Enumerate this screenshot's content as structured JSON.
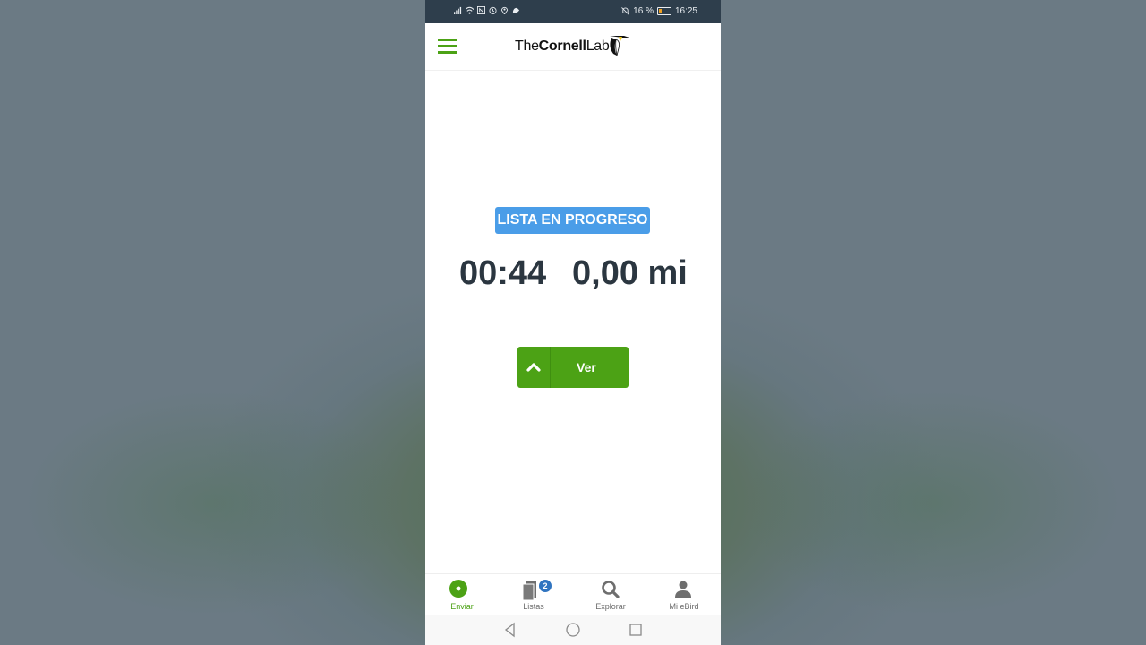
{
  "status_bar": {
    "battery_percent": "16 %",
    "time": "16:25",
    "icons": [
      "signal-icon",
      "wifi-icon",
      "nfc-icon",
      "alarm-icon",
      "location-icon",
      "app-notification-icon",
      "mute-icon",
      "battery-icon"
    ]
  },
  "header": {
    "logo_prefix": "The",
    "logo_bold": "Cornell",
    "logo_suffix": "Lab",
    "menu_icon": "hamburger-menu-icon"
  },
  "checklist": {
    "status_label": "LISTA EN PROGRESO",
    "elapsed_time": "00:44",
    "distance": "0,00 mi",
    "view_button_label": "Ver"
  },
  "bottom_nav": {
    "tabs": [
      {
        "label": "Enviar",
        "icon": "submit-dot-icon",
        "active": true
      },
      {
        "label": "Listas",
        "icon": "lists-icon",
        "badge": "2"
      },
      {
        "label": "Explorar",
        "icon": "search-icon"
      },
      {
        "label": "Mi eBird",
        "icon": "person-icon"
      }
    ]
  },
  "colors": {
    "accent_green": "#4ca215",
    "badge_blue": "#4a9de8",
    "status_bar_bg": "#2e3e4c",
    "text_dark": "#2b3640"
  }
}
